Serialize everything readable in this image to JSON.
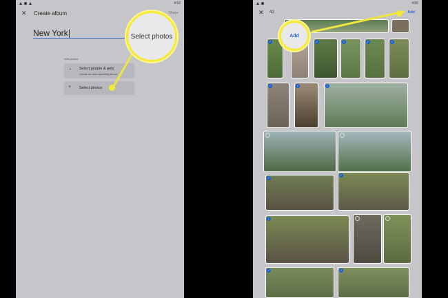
{
  "left": {
    "status_time": "4:52",
    "title": "Create album",
    "share_label": "Share",
    "album_name": "New York",
    "add_photos_label": "Add photos",
    "option_people_title": "Select people & pets",
    "option_people_subtitle": "Create an auto-updating album",
    "option_select_photos": "Select photos",
    "magnifier_text": "Select photos"
  },
  "right": {
    "status_time": "4:55",
    "selected_count": "42",
    "add_label": "Add",
    "magnifier_text": "Add"
  },
  "icons": {
    "close": "✕",
    "plus": "+",
    "people": "◔",
    "check": "✓"
  },
  "colors": {
    "accent": "#1a5fd0",
    "highlight": "#f5ea35"
  }
}
